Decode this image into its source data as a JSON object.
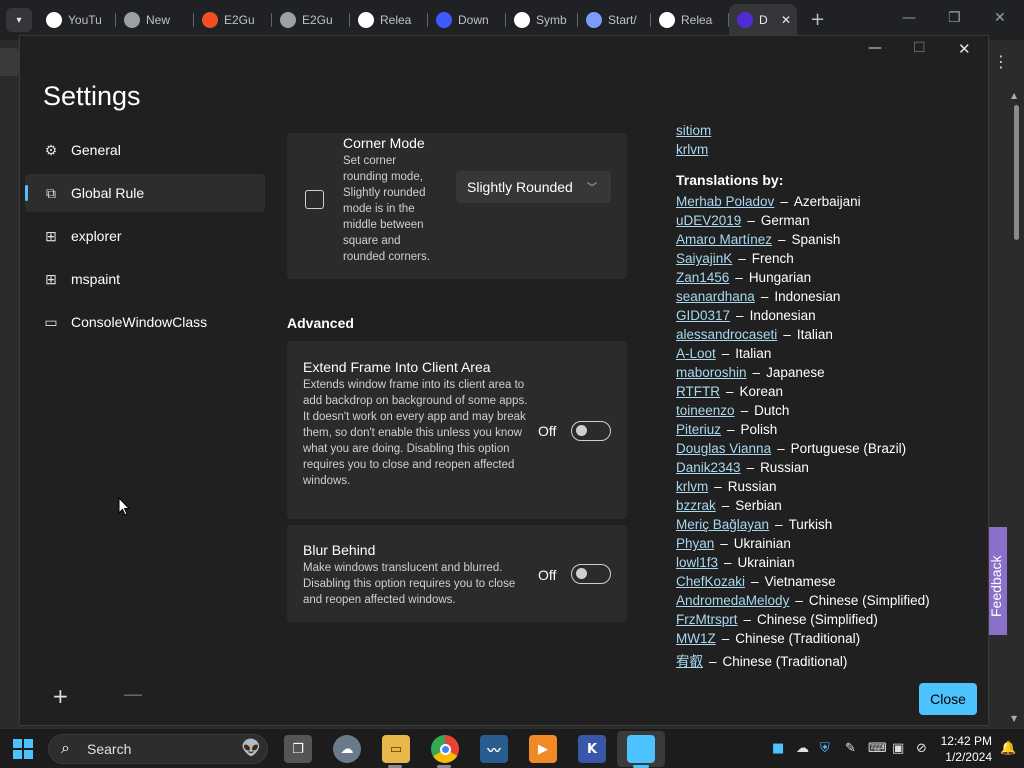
{
  "browser": {
    "tabs": [
      {
        "label": "YouTu",
        "icon": "google-icon",
        "color": "#ffffff"
      },
      {
        "label": "New",
        "icon": "chrome-icon",
        "color": "#9aa0a6"
      },
      {
        "label": "E2Gu",
        "icon": "microsoft-icon",
        "color": "#f25022"
      },
      {
        "label": "E2Gu",
        "icon": "globe-icon",
        "color": "#9aa0a6"
      },
      {
        "label": "Relea",
        "icon": "github-icon",
        "color": "#ffffff"
      },
      {
        "label": "Down",
        "icon": "v-logo-icon",
        "color": "#3d5afe"
      },
      {
        "label": "Symb",
        "icon": "github-icon",
        "color": "#ffffff"
      },
      {
        "label": "Start/",
        "icon": "document-icon",
        "color": "#7a9cff"
      },
      {
        "label": "Relea",
        "icon": "github-icon",
        "color": "#ffffff"
      },
      {
        "label": "D",
        "icon": "dotnet-icon",
        "color": "#512bd4"
      }
    ],
    "new_tab": "+",
    "menu": "⋮"
  },
  "app": {
    "title": "Settings",
    "controls": {
      "minimize": "—",
      "maximize": "☐",
      "close": "✕"
    }
  },
  "nav": {
    "items": [
      {
        "label": "General",
        "icon": "gear-icon",
        "selected": false
      },
      {
        "label": "Global Rule",
        "icon": "windows-stack-icon",
        "selected": true
      },
      {
        "label": "explorer",
        "icon": "app-window-icon",
        "selected": false
      },
      {
        "label": "mspaint",
        "icon": "app-window-icon",
        "selected": false
      },
      {
        "label": "ConsoleWindowClass",
        "icon": "window-icon",
        "selected": false
      }
    ],
    "add": "+",
    "remove": "—"
  },
  "corner_mode": {
    "title": "Corner Mode",
    "description": "Set corner rounding mode, Slightly rounded mode is in the middle between square and rounded corners.",
    "checked": false,
    "value": "Slightly Rounded"
  },
  "advanced": {
    "heading": "Advanced",
    "extend_frame": {
      "title": "Extend Frame Into Client Area",
      "description": "Extends window frame into its client area to add backdrop on background of some apps. It doesn't work on every app and may break them, so don't enable this unless you know what you are doing. Disabling this option requires you to close and reopen affected windows.",
      "state": "Off"
    },
    "blur_behind": {
      "title": "Blur Behind",
      "description": "Make windows translucent and blurred. Disabling this option requires you to close and reopen affected windows.",
      "state": "Off"
    }
  },
  "credits": {
    "top_links": [
      "sitiom",
      "krlvm"
    ],
    "translations_heading": "Translations by:",
    "translations": [
      {
        "name": "Merhab Poladov",
        "language": "Azerbaijani"
      },
      {
        "name": "uDEV2019",
        "language": "German"
      },
      {
        "name": "Amaro Martínez",
        "language": "Spanish"
      },
      {
        "name": "SaiyajinK",
        "language": "French"
      },
      {
        "name": "Zan1456",
        "language": "Hungarian"
      },
      {
        "name": "seanardhana",
        "language": "Indonesian"
      },
      {
        "name": "GID0317",
        "language": "Indonesian"
      },
      {
        "name": "alessandrocaseti",
        "language": "Italian"
      },
      {
        "name": "A-Loot",
        "language": "Italian"
      },
      {
        "name": "maboroshin",
        "language": "Japanese"
      },
      {
        "name": "RTFTR",
        "language": "Korean"
      },
      {
        "name": "toineenzo",
        "language": "Dutch"
      },
      {
        "name": "Piteriuz",
        "language": "Polish"
      },
      {
        "name": "Douglas Vianna",
        "language": "Portuguese (Brazil)"
      },
      {
        "name": "Danik2343",
        "language": "Russian"
      },
      {
        "name": "krlvm",
        "language": "Russian"
      },
      {
        "name": "bzzrak",
        "language": "Serbian"
      },
      {
        "name": "Meriç Bağlayan",
        "language": "Turkish"
      },
      {
        "name": "Phyan",
        "language": "Ukrainian"
      },
      {
        "name": "lowl1f3",
        "language": "Ukrainian"
      },
      {
        "name": "ChefKozaki",
        "language": "Vietnamese"
      },
      {
        "name": "AndromedaMelody",
        "language": "Chinese (Simplified)"
      },
      {
        "name": "FrzMtrsprt",
        "language": "Chinese (Simplified)"
      },
      {
        "name": "MW1Z",
        "language": "Chinese (Traditional)"
      },
      {
        "name": "宥叡",
        "language": "Chinese (Traditional)"
      }
    ],
    "separator": "–"
  },
  "close_button": "Close",
  "feedback": "Feedback",
  "taskbar": {
    "search_placeholder": "Search",
    "time": "12:42 PM",
    "date": "1/2/2024",
    "apps": [
      "task-view-icon",
      "weather-icon",
      "file-explorer-icon",
      "chrome-icon",
      "resource-monitor-icon",
      "media-player-icon",
      "k-app-icon",
      "active-app-icon"
    ]
  },
  "colors": {
    "accent": "#4cc2ff",
    "link": "#a8d8f0",
    "feedback": "#8a70c9"
  }
}
